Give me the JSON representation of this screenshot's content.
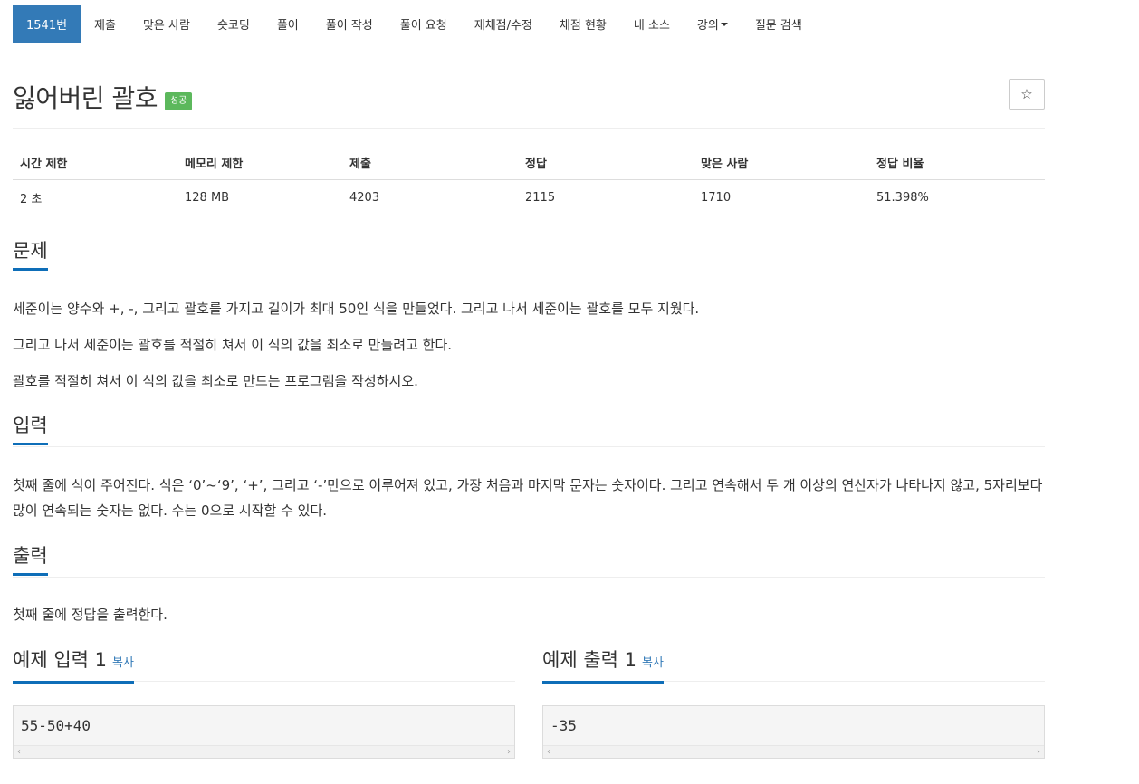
{
  "nav": [
    {
      "label": "1541번",
      "active": true
    },
    {
      "label": "제출"
    },
    {
      "label": "맞은 사람"
    },
    {
      "label": "숏코딩"
    },
    {
      "label": "풀이"
    },
    {
      "label": "풀이 작성"
    },
    {
      "label": "풀이 요청"
    },
    {
      "label": "재채점/수정"
    },
    {
      "label": "채점 현황"
    },
    {
      "label": "내 소스"
    },
    {
      "label": "강의",
      "dropdown": true
    },
    {
      "label": "질문 검색"
    }
  ],
  "problem": {
    "title": "잃어버린 괄호",
    "badge": "성공",
    "badge_color": "#5cb85c",
    "star": "☆"
  },
  "info_table": {
    "headers": [
      "시간 제한",
      "메모리 제한",
      "제출",
      "정답",
      "맞은 사람",
      "정답 비율"
    ],
    "values": [
      "2 초",
      "128 MB",
      "4203",
      "2115",
      "1710",
      "51.398%"
    ]
  },
  "sections": {
    "description": {
      "heading": "문제",
      "paragraphs": [
        "세준이는 양수와 +, -, 그리고 괄호를 가지고 길이가 최대 50인 식을 만들었다. 그리고 나서 세준이는 괄호를 모두 지웠다.",
        "그리고 나서 세준이는 괄호를 적절히 쳐서 이 식의 값을 최소로 만들려고 한다.",
        "괄호를 적절히 쳐서 이 식의 값을 최소로 만드는 프로그램을 작성하시오."
      ]
    },
    "input": {
      "heading": "입력",
      "text": "첫째 줄에 식이 주어진다. 식은 ‘0’~‘9’, ‘+’, 그리고 ‘-’만으로 이루어져 있고, 가장 처음과 마지막 문자는 숫자이다. 그리고 연속해서 두 개 이상의 연산자가 나타나지 않고, 5자리보다 많이 연속되는 숫자는 없다. 수는 0으로 시작할 수 있다."
    },
    "output": {
      "heading": "출력",
      "text": "첫째 줄에 정답을 출력한다."
    }
  },
  "samples": {
    "input": {
      "heading": "예제 입력 1",
      "copy": "복사",
      "code": "55-50+40"
    },
    "output": {
      "heading": "예제 출력 1",
      "copy": "복사",
      "code": "-35"
    }
  },
  "colors": {
    "accent": "#337ab7",
    "heading_underline": "#0e6eb8"
  }
}
